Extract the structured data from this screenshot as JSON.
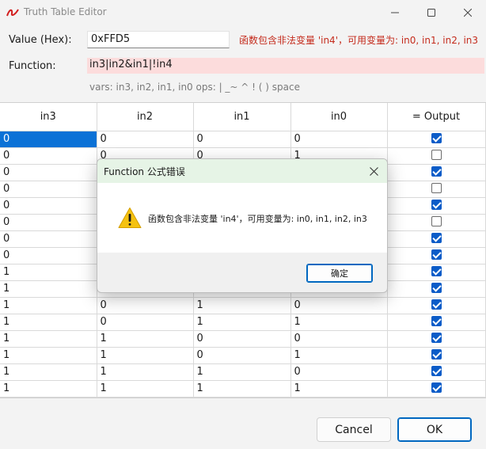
{
  "window": {
    "title": "Truth Table Editor",
    "minimize": "—",
    "maximize": "☐",
    "close": "✕"
  },
  "form": {
    "hex_label": "Value (Hex):",
    "hex_value": "0xFFD5",
    "error_message": "函数包含非法变量 'in4'，可用变量为: in0, in1, in2, in3",
    "function_label": "Function:",
    "function_value": "in3|in2&in1|!in4",
    "hint": "vars: in3, in2, in1, in0    ops: | _~ ^ ! ( ) space"
  },
  "table": {
    "headers": [
      "in3",
      "in2",
      "in1",
      "in0",
      "= Output"
    ],
    "rows": [
      {
        "in3": "0",
        "in2": "0",
        "in1": "0",
        "in0": "0",
        "out": true
      },
      {
        "in3": "0",
        "in2": "0",
        "in1": "0",
        "in0": "1",
        "out": false
      },
      {
        "in3": "0",
        "in2": "",
        "in1": "",
        "in0": "",
        "out": true
      },
      {
        "in3": "0",
        "in2": "",
        "in1": "",
        "in0": "",
        "out": false
      },
      {
        "in3": "0",
        "in2": "",
        "in1": "",
        "in0": "",
        "out": true
      },
      {
        "in3": "0",
        "in2": "",
        "in1": "",
        "in0": "",
        "out": false
      },
      {
        "in3": "0",
        "in2": "",
        "in1": "",
        "in0": "",
        "out": true
      },
      {
        "in3": "0",
        "in2": "",
        "in1": "",
        "in0": "",
        "out": true
      },
      {
        "in3": "1",
        "in2": "",
        "in1": "",
        "in0": "",
        "out": true
      },
      {
        "in3": "1",
        "in2": "",
        "in1": "",
        "in0": "",
        "out": true
      },
      {
        "in3": "1",
        "in2": "0",
        "in1": "1",
        "in0": "0",
        "out": true
      },
      {
        "in3": "1",
        "in2": "0",
        "in1": "1",
        "in0": "1",
        "out": true
      },
      {
        "in3": "1",
        "in2": "1",
        "in1": "0",
        "in0": "0",
        "out": true
      },
      {
        "in3": "1",
        "in2": "1",
        "in1": "0",
        "in0": "1",
        "out": true
      },
      {
        "in3": "1",
        "in2": "1",
        "in1": "1",
        "in0": "0",
        "out": true
      },
      {
        "in3": "1",
        "in2": "1",
        "in1": "1",
        "in0": "1",
        "out": true
      }
    ]
  },
  "buttons": {
    "cancel": "Cancel",
    "ok": "OK"
  },
  "dialog": {
    "title": "Function 公式错误",
    "message": "函数包含非法变量 'in4'，可用变量为: in0, in1, in2, in3",
    "ok": "确定",
    "close": "✕",
    "icon": "warning-icon"
  },
  "colors": {
    "accent": "#0067c0",
    "error_text": "#c42b1c",
    "error_field_bg": "#fcdcdc",
    "selection": "#0b72d6",
    "dialog_title_bg": "#e6f4e6"
  }
}
